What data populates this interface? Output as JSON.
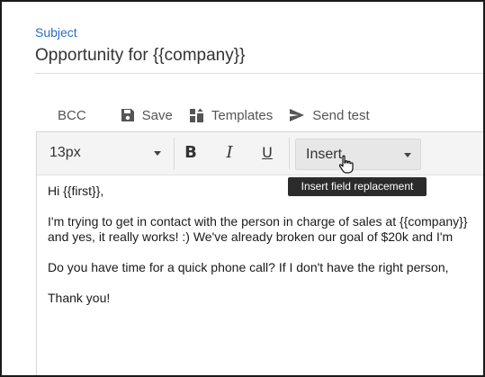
{
  "subject": {
    "label": "Subject",
    "value": "Opportunity for {{company}}"
  },
  "actions": {
    "bcc": "BCC",
    "save": "Save",
    "templates": "Templates",
    "send_test": "Send test"
  },
  "format_bar": {
    "font_size": "13px",
    "bold": "B",
    "italic": "I",
    "underline": "U",
    "insert": "Insert"
  },
  "tooltip": "Insert field replacement",
  "email_body": {
    "greeting": "Hi {{first}},",
    "line1": "I'm trying to get in contact with the person in charge of sales at {{company}}",
    "line2": "and yes, it really works! :) We've already broken our goal of $20k and I'm",
    "line3": "Do you have time for a quick phone call? If I don't have the right person,",
    "closing": "Thank you!"
  },
  "colors": {
    "subject_label": "#2b6cc4",
    "format_bar_bg": "#f4f4f4",
    "tooltip_bg": "#2b2b2b"
  },
  "icons": [
    "save-icon",
    "templates-icon",
    "send-icon",
    "chevron-down-icon",
    "hand-cursor-icon"
  ]
}
